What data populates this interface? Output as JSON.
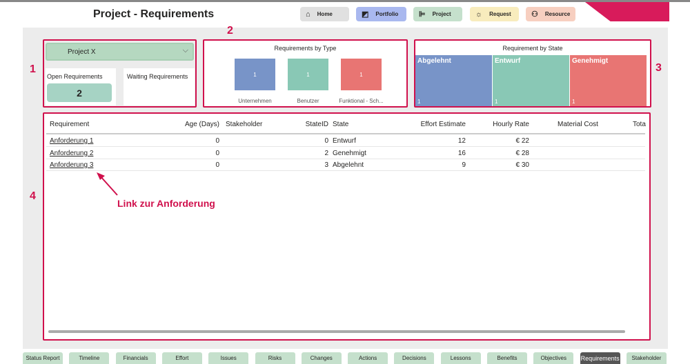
{
  "header": {
    "title": "Project - Requirements"
  },
  "nav": [
    {
      "label": "Home",
      "icon": "home-icon",
      "color": "#e0e0e0"
    },
    {
      "label": "Portfolio",
      "icon": "chart-icon",
      "color": "#a9b8ef"
    },
    {
      "label": "Project",
      "icon": "gantt-icon",
      "color": "#c5e0cc"
    },
    {
      "label": "Request",
      "icon": "lightbulb-icon",
      "color": "#f8ecbd"
    },
    {
      "label": "Resource",
      "icon": "people-icon",
      "color": "#f7cfc0"
    }
  ],
  "annotations": {
    "n1": "1",
    "n2": "2",
    "n3": "3",
    "n4": "4",
    "link_note": "Link zur Anforderung"
  },
  "filter": {
    "selected": "Project X"
  },
  "cards": {
    "open_label": "Open Requirements",
    "open_value": "2",
    "waiting_label": "Waiting Requirements"
  },
  "chart_data": [
    {
      "type": "bar",
      "title": "Requirements by Type",
      "categories": [
        "Unternehmen",
        "Benutzer",
        "Funktional - Sch..."
      ],
      "values": [
        1,
        1,
        1
      ],
      "colors": [
        "#7894c8",
        "#89c8b5",
        "#e87573"
      ]
    },
    {
      "type": "treemap",
      "title": "Requirement by State",
      "categories": [
        "Abgelehnt",
        "Entwurf",
        "Genehmigt"
      ],
      "values": [
        1,
        1,
        1
      ],
      "colors": [
        "#7894c8",
        "#89c8b5",
        "#e87573"
      ]
    }
  ],
  "table": {
    "columns": [
      "Requirement",
      "Age (Days)",
      "Stakeholder",
      "StateID",
      "State",
      "Effort Estimate",
      "Hourly Rate",
      "Material Cost",
      "Tota"
    ],
    "rows": [
      [
        "Anforderung 1",
        "0",
        "",
        "0",
        "Entwurf",
        "12",
        "€ 22",
        ""
      ],
      [
        "Anforderung 2",
        "0",
        "",
        "2",
        "Genehmigt",
        "16",
        "€ 28",
        ""
      ],
      [
        "Anforderung 3",
        "0",
        "",
        "3",
        "Abgelehnt",
        "9",
        "€ 30",
        ""
      ]
    ]
  },
  "tabs": [
    "Status Report",
    "Timeline",
    "Financials",
    "Effort",
    "Issues",
    "Risks",
    "Changes",
    "Actions",
    "Decisions",
    "Lessons",
    "Benefits",
    "Objectives",
    "Requirements",
    "Stakeholder"
  ],
  "active_tab": "Requirements",
  "accent": "#d0104c"
}
